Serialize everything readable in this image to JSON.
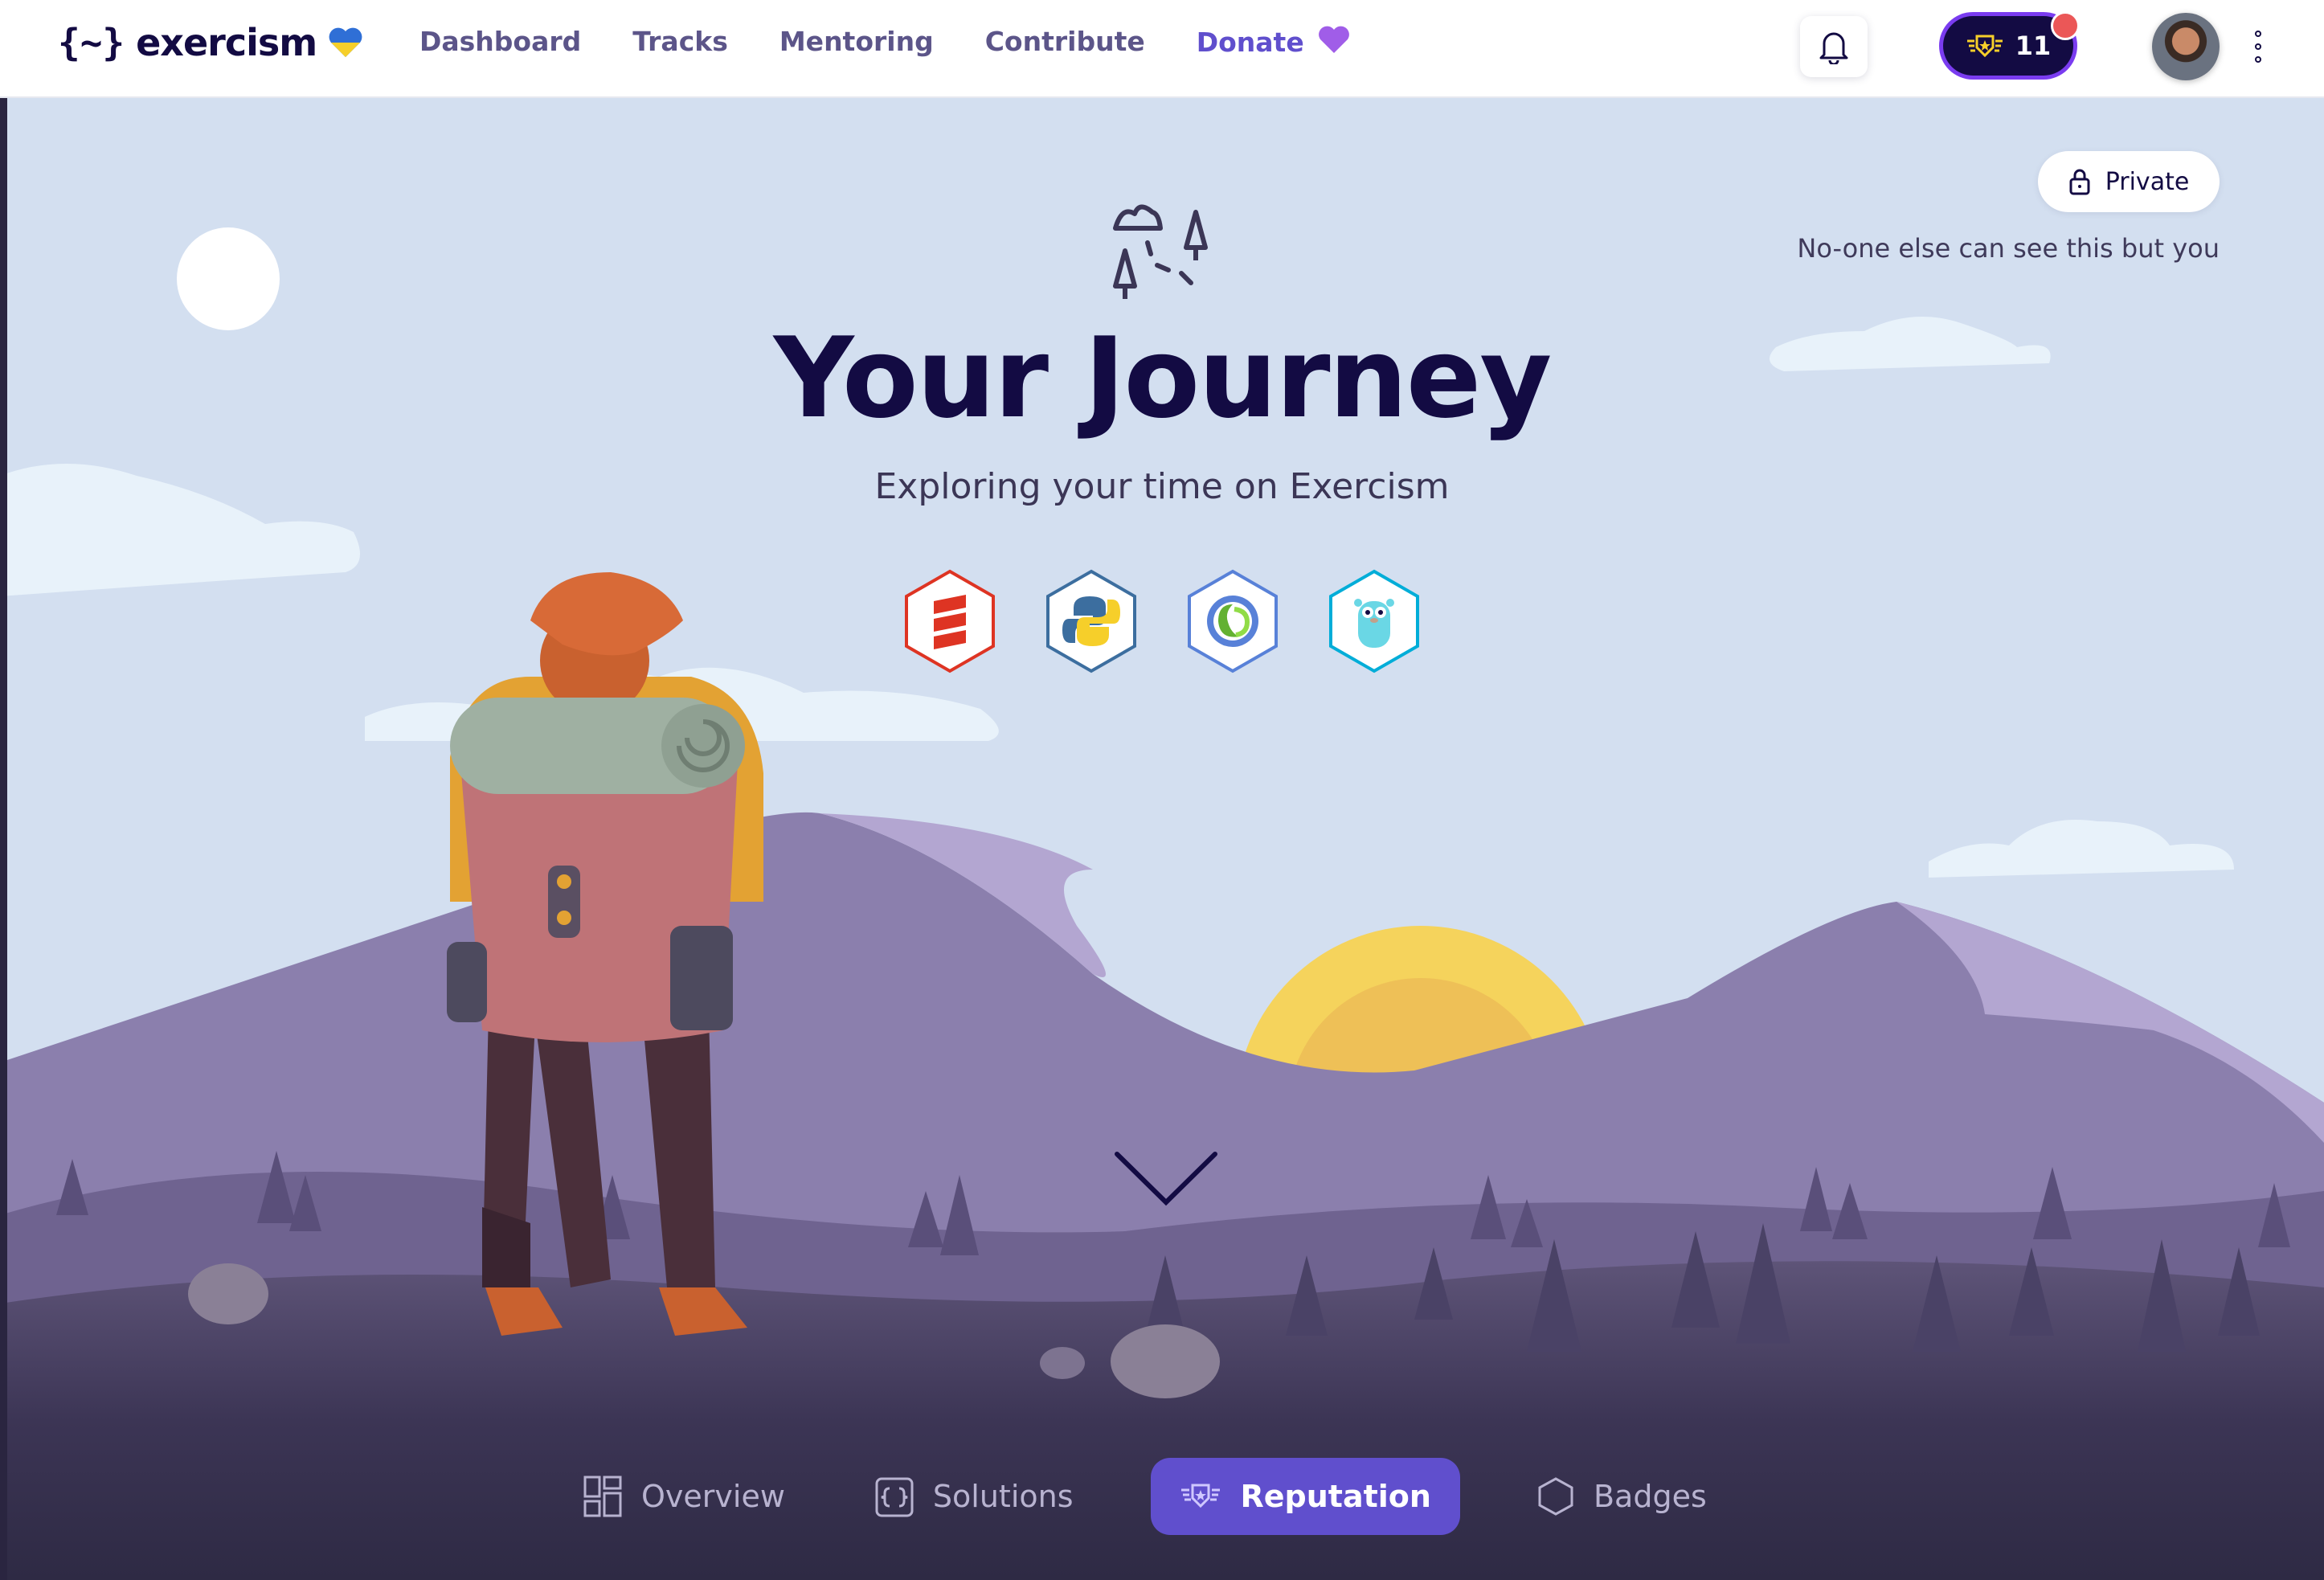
{
  "header": {
    "logo_mark": "{~}",
    "logo_text": "exercism",
    "nav": [
      "Dashboard",
      "Tracks",
      "Mentoring",
      "Contribute",
      "Donate"
    ],
    "reputation_count": "11"
  },
  "hero": {
    "privacy_label": "Private",
    "privacy_note": "No-one else can see this but you",
    "title": "Your Journey",
    "subtitle": "Exploring your time on Exercism",
    "tracks": [
      {
        "icon": "scala-icon",
        "color": "#de3423"
      },
      {
        "icon": "python-icon",
        "color": "#3c6e9f"
      },
      {
        "icon": "clojure-icon",
        "color": "#5881d8"
      },
      {
        "icon": "go-icon",
        "color": "#00add8"
      }
    ]
  },
  "tabs": [
    {
      "label": "Overview",
      "icon": "overview-icon",
      "active": false
    },
    {
      "label": "Solutions",
      "icon": "solutions-icon",
      "active": false
    },
    {
      "label": "Reputation",
      "icon": "reputation-icon",
      "active": true
    },
    {
      "label": "Badges",
      "icon": "badges-icon",
      "active": false
    }
  ],
  "colors": {
    "brand": "#130b43",
    "accent": "#604fcd",
    "sky": "#d3dff0"
  }
}
